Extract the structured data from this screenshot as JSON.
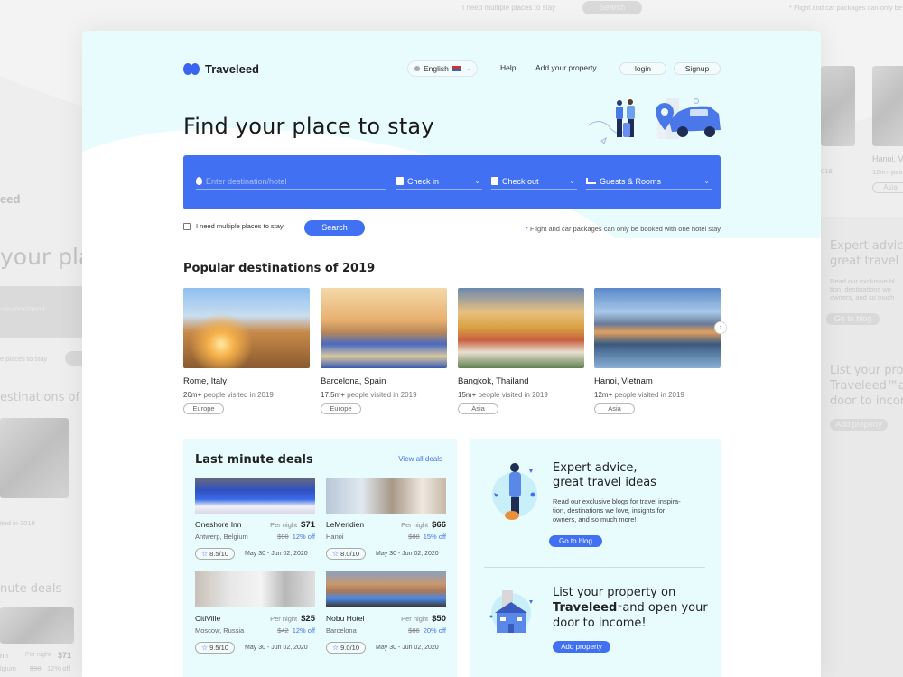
{
  "background": {
    "left": {
      "logo_fragment": "eed",
      "title_fragment": "your plac",
      "input_fragment": "stination/hotel",
      "checkbox_fragment": "e places to stay",
      "section_fragment": "estinations of 2",
      "visited_fragment": "ited in 2019",
      "deals_fragment": "nute deals",
      "deal_name_fragment": "nn",
      "deal_loc_fragment": "lgium",
      "per_night": "Per night",
      "price": "$71",
      "old_price": "$90",
      "discount": "12% off"
    },
    "top": {
      "checkbox_label": "I need multiple places to stay",
      "search_label": "Search",
      "note": "* Flight and car packages can only be booked with one hotel stay"
    },
    "right": {
      "visited_fragment": "019",
      "dest_name": "Hanoi, V",
      "dest_sub": "12m+ peo",
      "dest_tag": "Asia",
      "expert_title_1": "Expert advice",
      "expert_title_2": "great travel i",
      "expert_text_1": "Read our exclusive bl",
      "expert_text_2": "tion, destinations we",
      "expert_text_3": "owners, and so much",
      "blog_btn": "Go to blog",
      "list_title_1": "List your pro",
      "list_title_2": "Traveleed™ar",
      "list_title_3": "door to incor",
      "add_btn": "Add property"
    }
  },
  "header": {
    "brand": "Traveleed",
    "language": "English",
    "nav": [
      "Help",
      "Add your property"
    ],
    "login": "login",
    "signup": "Signup"
  },
  "hero": {
    "title": "Find your place to stay"
  },
  "search": {
    "destination_placeholder": "Enter destination/hotel",
    "checkin": "Check in",
    "checkout": "Check out",
    "guests": "Guests & Rooms",
    "multiple_label": "I need multiple places to stay",
    "button": "Search",
    "note_asterisk": "*",
    "note": "Flight and car packages can only be booked with one hotel stay"
  },
  "destinations": {
    "title": "Popular destinations of 2019",
    "items": [
      {
        "name": "Rome, Italy",
        "count": "20m+",
        "suffix": "people visited in 2019",
        "tag": "Europe"
      },
      {
        "name": "Barcelona, Spain",
        "count": "17.5m+",
        "suffix": "people visited in 2019",
        "tag": "Europe"
      },
      {
        "name": "Bangkok, Thailand",
        "count": "15m+",
        "suffix": "people visited in 2019",
        "tag": "Asia"
      },
      {
        "name": "Hanoi, Vietnam",
        "count": "12m+",
        "suffix": "people visited in 2019",
        "tag": "Asia"
      }
    ]
  },
  "deals": {
    "title": "Last minute deals",
    "view_all": "View all deals",
    "per_night_label": "Per night",
    "items": [
      {
        "name": "Oneshore Inn",
        "location": "Antwerp, Belgium",
        "price": "$71",
        "old_price": "$90",
        "discount": "12% off",
        "rating": "8.5/10",
        "dates": "May 30 - Jun 02,  2020"
      },
      {
        "name": "LeMeridien",
        "location": "Hanoi",
        "price": "$66",
        "old_price": "$88",
        "discount": "15% off",
        "rating": "8.0/10",
        "dates": "May 30 - Jun 02,  2020"
      },
      {
        "name": "CitiVille",
        "location": "Moscow, Russia",
        "price": "$25",
        "old_price": "$42",
        "discount": "12% off",
        "rating": "9.5/10",
        "dates": "May 30 - Jun 02,  2020"
      },
      {
        "name": "Nobu Hotel",
        "location": "Barcelona",
        "price": "$50",
        "old_price": "$86",
        "discount": "20% off",
        "rating": "9.0/10",
        "dates": "May 30 - Jun 02,  2020"
      }
    ]
  },
  "expert": {
    "title_line1": "Expert advice,",
    "title_line2": "great travel ideas",
    "text_line1": "Read our exclusive blogs for travel inspira-",
    "text_line2": "tion, destinations we love, insights for",
    "text_line3": "owners, and so much more!",
    "button": "Go to blog"
  },
  "list_property": {
    "title_line1": "List your property on",
    "brand": "Traveleed",
    "trademark": "™",
    "title_line2_rest": "and open your",
    "title_line3": "door to income!",
    "button": "Add property"
  },
  "colors": {
    "accent": "#4170f2",
    "hero_bg": "#e8fbfd",
    "panel_bg": "#e8fbfd"
  }
}
